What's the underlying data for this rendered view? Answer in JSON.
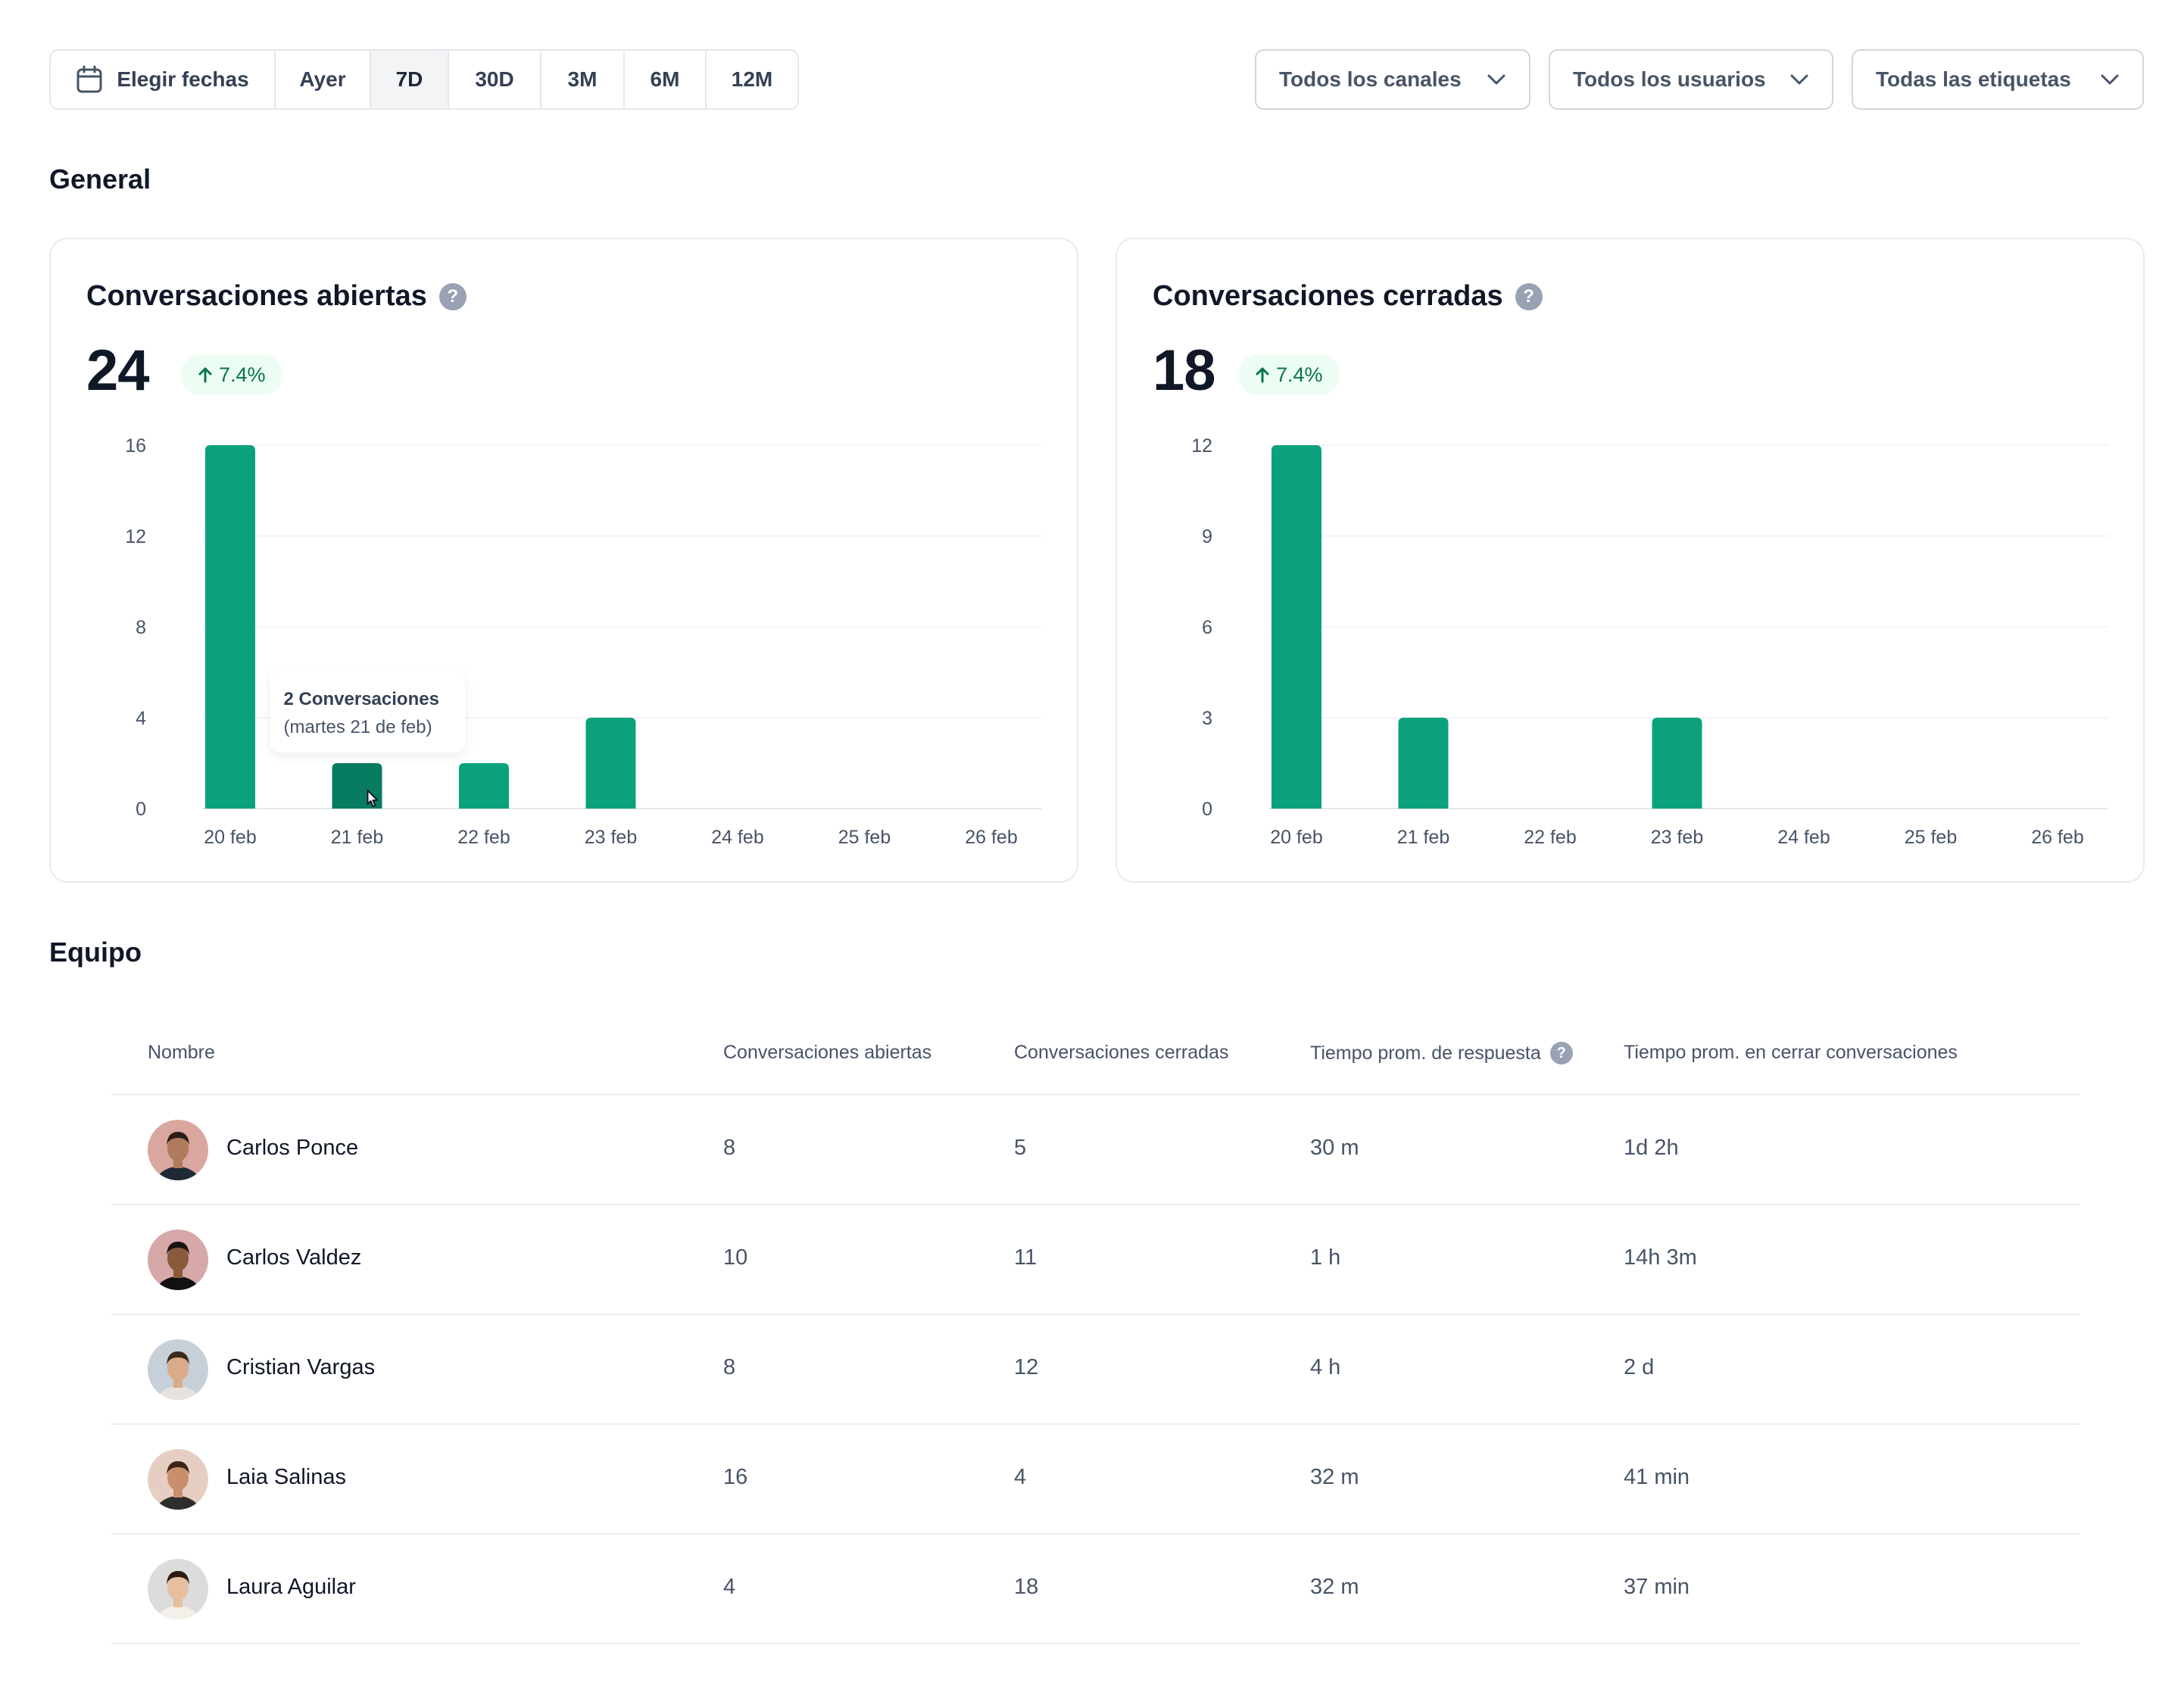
{
  "filters": {
    "date_button": "Elegir fechas",
    "ranges": [
      "Ayer",
      "7D",
      "30D",
      "3M",
      "6M",
      "12M"
    ],
    "active_range": "7D",
    "channels": "Todos los canales",
    "users": "Todos los usuarios",
    "tags": "Todas las etiquetas"
  },
  "sections": {
    "general": "General",
    "team": "Equipo"
  },
  "cards": [
    {
      "title": "Conversaciones abiertas",
      "value": "24",
      "change": "7.4%",
      "tooltip": {
        "title": "2 Conversaciones",
        "subtitle": "(martes 21 de feb)"
      }
    },
    {
      "title": "Conversaciones cerradas",
      "value": "18",
      "change": "7.4%"
    }
  ],
  "chart_data": [
    {
      "type": "bar",
      "categories": [
        "20 feb",
        "21 feb",
        "22 feb",
        "23 feb",
        "24 feb",
        "25 feb",
        "26 feb"
      ],
      "values": [
        16,
        2,
        2,
        4,
        0,
        0,
        0
      ],
      "yticks": [
        0,
        4,
        8,
        12,
        16
      ],
      "ylim": [
        0,
        16
      ],
      "highlight_index": 1,
      "color": "#0ba17d",
      "highlight_color": "#087c60",
      "grid": true
    },
    {
      "type": "bar",
      "categories": [
        "20 feb",
        "21 feb",
        "22 feb",
        "23 feb",
        "24 feb",
        "25 feb",
        "26 feb"
      ],
      "values": [
        12,
        3,
        0,
        3,
        0,
        0,
        0
      ],
      "yticks": [
        0,
        3,
        6,
        9,
        12
      ],
      "ylim": [
        0,
        12
      ],
      "color": "#0ba17d",
      "grid": true
    }
  ],
  "table": {
    "headers": {
      "name": "Nombre",
      "open": "Conversaciones abiertas",
      "closed": "Conversaciones cerradas",
      "response": "Tiempo prom. de respuesta",
      "close_time": "Tiempo prom. en cerrar conversaciones"
    },
    "rows": [
      {
        "name": "Carlos Ponce",
        "open": "8",
        "closed": "5",
        "response": "30 m",
        "close_time": "1d 2h",
        "avatar_bg": "#d9a6a0",
        "skin": "#b07a5c",
        "hair": "#2b1d16",
        "shirt": "#1f2a36"
      },
      {
        "name": "Carlos Valdez",
        "open": "10",
        "closed": "11",
        "response": "1 h",
        "close_time": "14h 3m",
        "avatar_bg": "#d7a8a8",
        "skin": "#8a5a3c",
        "hair": "#1a1210",
        "shirt": "#111111"
      },
      {
        "name": "Cristian Vargas",
        "open": "8",
        "closed": "12",
        "response": "4 h",
        "close_time": "2 d",
        "avatar_bg": "#c7d0d8",
        "skin": "#d9ab88",
        "hair": "#3a2a1e",
        "shirt": "#e7e3dc"
      },
      {
        "name": "Laia Salinas",
        "open": "16",
        "closed": "4",
        "response": "32 m",
        "close_time": "41 min",
        "avatar_bg": "#e6cfc2",
        "skin": "#c98f6c",
        "hair": "#3b2418",
        "shirt": "#2d2d2d"
      },
      {
        "name": "Laura Aguilar",
        "open": "4",
        "closed": "18",
        "response": "32 m",
        "close_time": "37 min",
        "avatar_bg": "#dcdcdc",
        "skin": "#e5bf9f",
        "hair": "#2a1a12",
        "shirt": "#f4efe8"
      }
    ]
  }
}
